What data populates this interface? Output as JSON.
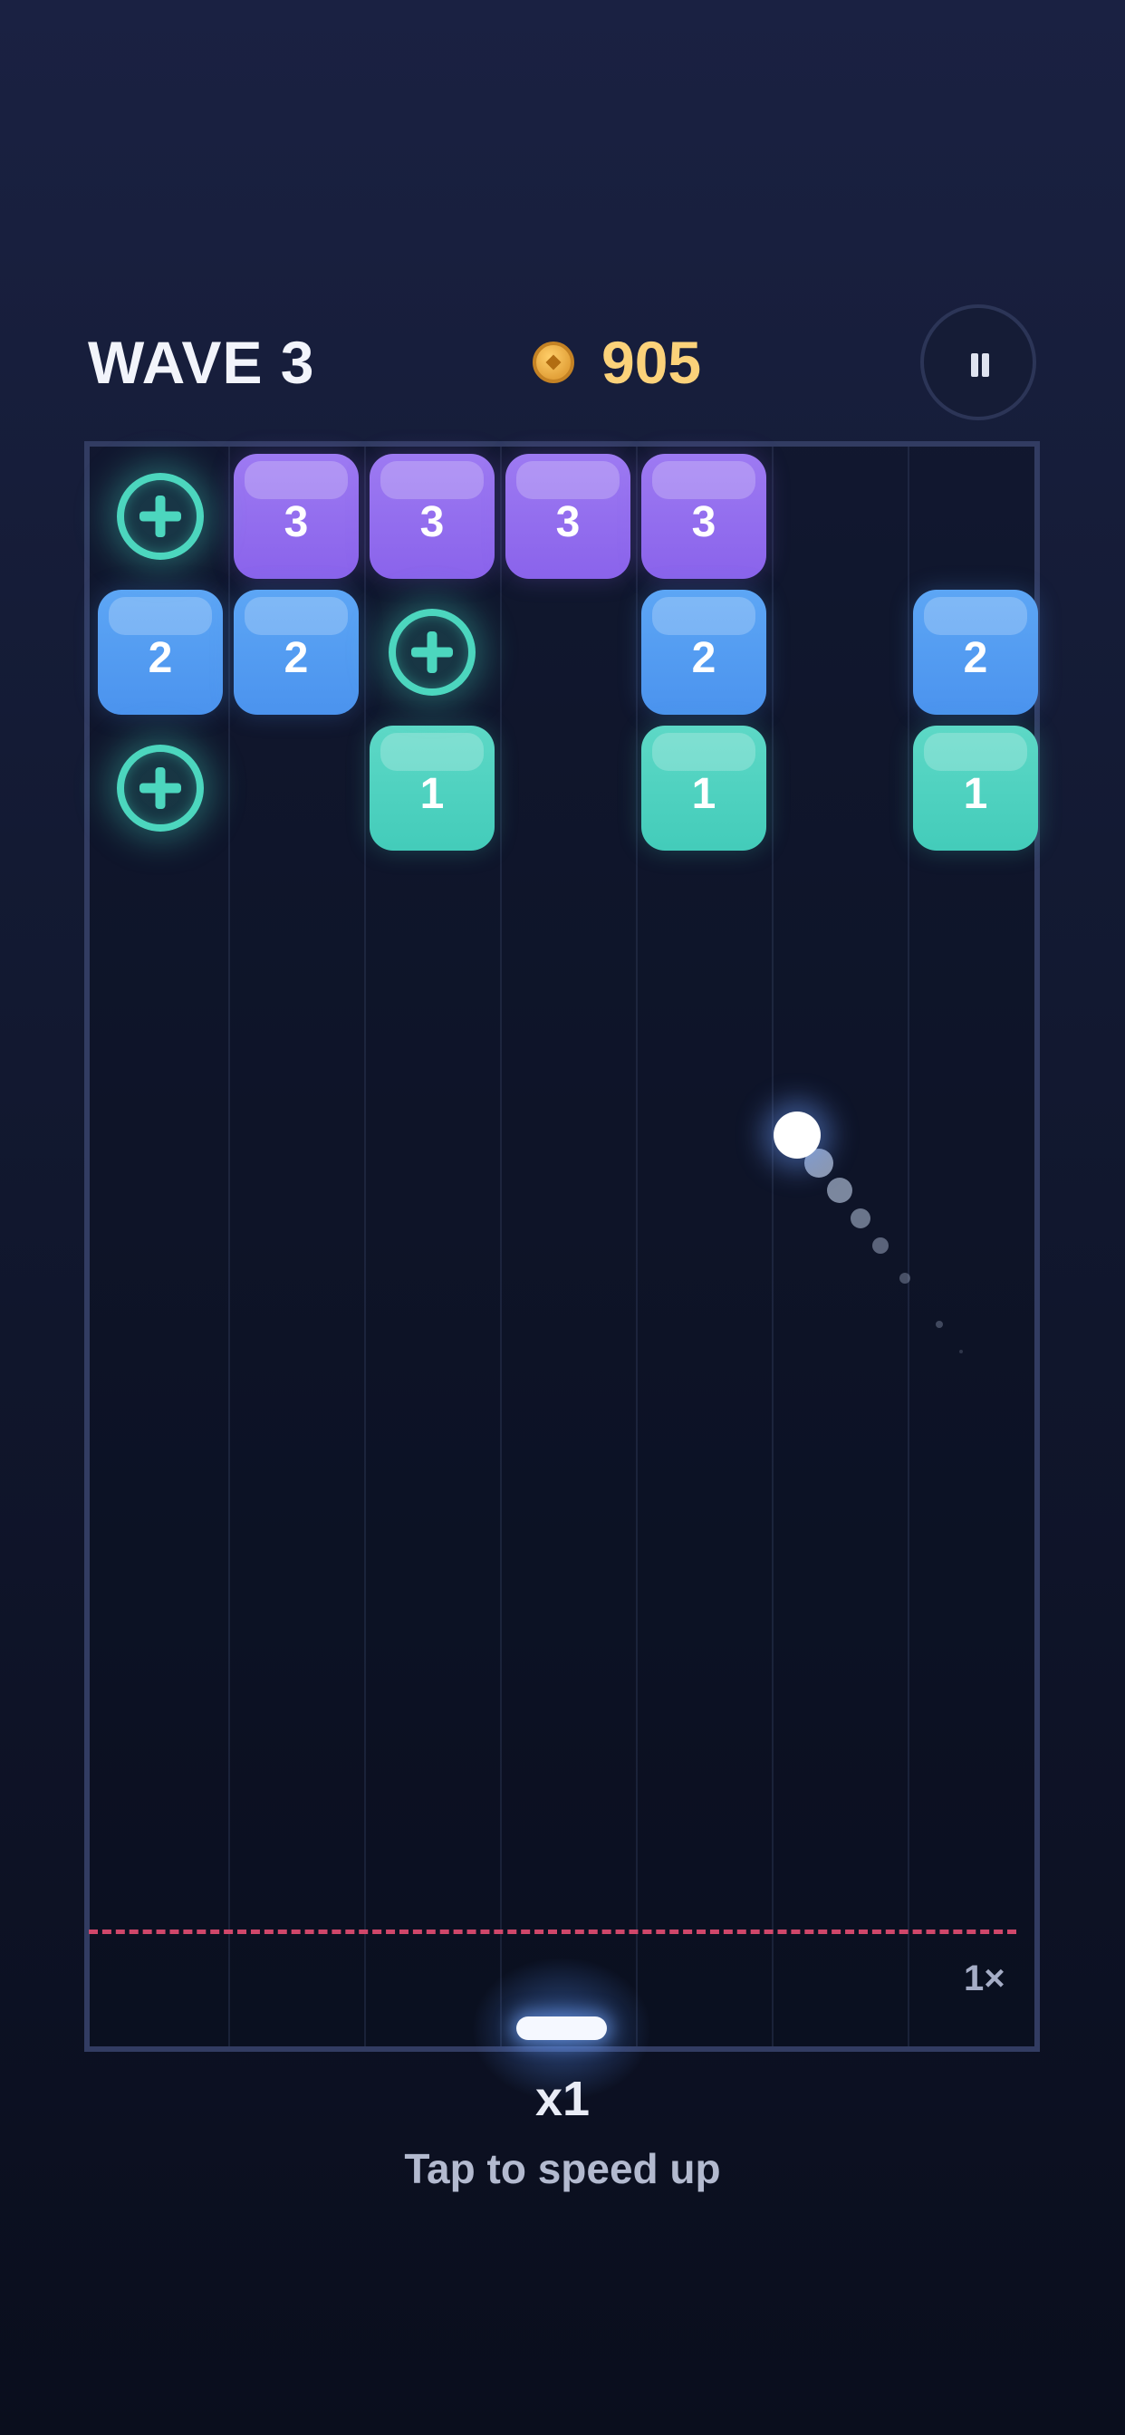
{
  "hud": {
    "wave_label": "WAVE 3",
    "coin_count": "905",
    "coin_icon": "coin-icon",
    "pause_icon": "pause-icon"
  },
  "board": {
    "columns": 7,
    "blocks": [
      {
        "row": 0,
        "col": 1,
        "value": "3",
        "color": "purple"
      },
      {
        "row": 0,
        "col": 2,
        "value": "3",
        "color": "purple"
      },
      {
        "row": 0,
        "col": 3,
        "value": "3",
        "color": "purple"
      },
      {
        "row": 0,
        "col": 4,
        "value": "3",
        "color": "purple"
      },
      {
        "row": 1,
        "col": 0,
        "value": "2",
        "color": "blue"
      },
      {
        "row": 1,
        "col": 1,
        "value": "2",
        "color": "blue"
      },
      {
        "row": 1,
        "col": 4,
        "value": "2",
        "color": "blue"
      },
      {
        "row": 1,
        "col": 6,
        "value": "2",
        "color": "blue"
      },
      {
        "row": 2,
        "col": 2,
        "value": "1",
        "color": "teal"
      },
      {
        "row": 2,
        "col": 4,
        "value": "1",
        "color": "teal"
      },
      {
        "row": 2,
        "col": 6,
        "value": "1",
        "color": "teal"
      }
    ],
    "powerups": [
      {
        "row": 0,
        "col": 0,
        "icon": "plus-ball-icon"
      },
      {
        "row": 1,
        "col": 2,
        "icon": "plus-ball-icon"
      },
      {
        "row": 2,
        "col": 0,
        "icon": "plus-ball-icon"
      }
    ],
    "speed_corner_label": "1×"
  },
  "footer": {
    "multiplier_label": "x1",
    "hint_label": "Tap to speed up"
  },
  "colors": {
    "purple": "#8f69ee",
    "blue": "#5099f0",
    "teal": "#48d0be",
    "danger": "#d0476a",
    "coin_text": "#fbd27a"
  }
}
